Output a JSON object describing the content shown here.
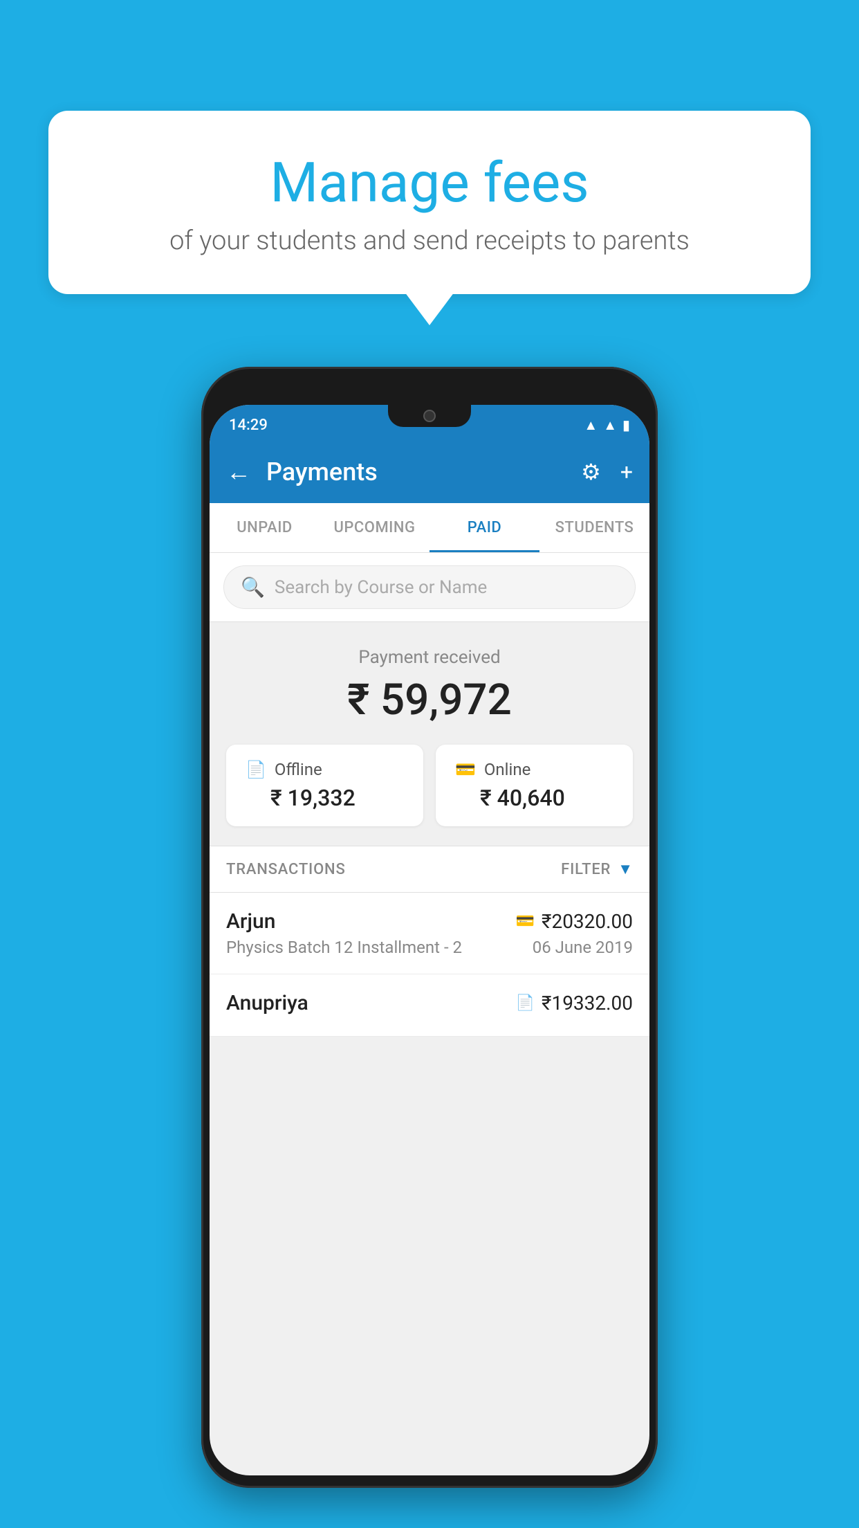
{
  "background_color": "#1EAEE4",
  "speech_bubble": {
    "title": "Manage fees",
    "subtitle": "of your students and send receipts to parents"
  },
  "status_bar": {
    "time": "14:29",
    "wifi": "▲",
    "signal": "▲",
    "battery": "▮"
  },
  "header": {
    "title": "Payments",
    "back_label": "←",
    "settings_label": "⚙",
    "add_label": "+"
  },
  "tabs": [
    {
      "label": "UNPAID",
      "active": false
    },
    {
      "label": "UPCOMING",
      "active": false
    },
    {
      "label": "PAID",
      "active": true
    },
    {
      "label": "STUDENTS",
      "active": false
    }
  ],
  "search": {
    "placeholder": "Search by Course or Name"
  },
  "payment_summary": {
    "label": "Payment received",
    "amount": "₹ 59,972",
    "offline": {
      "icon": "📄",
      "label": "Offline",
      "amount": "₹ 19,332"
    },
    "online": {
      "icon": "💳",
      "label": "Online",
      "amount": "₹ 40,640"
    }
  },
  "transactions": {
    "label": "TRANSACTIONS",
    "filter_label": "FILTER",
    "items": [
      {
        "name": "Arjun",
        "payment_mode_icon": "💳",
        "amount": "₹20320.00",
        "detail": "Physics Batch 12 Installment - 2",
        "date": "06 June 2019"
      },
      {
        "name": "Anupriya",
        "payment_mode_icon": "📄",
        "amount": "₹19332.00",
        "detail": "",
        "date": ""
      }
    ]
  }
}
